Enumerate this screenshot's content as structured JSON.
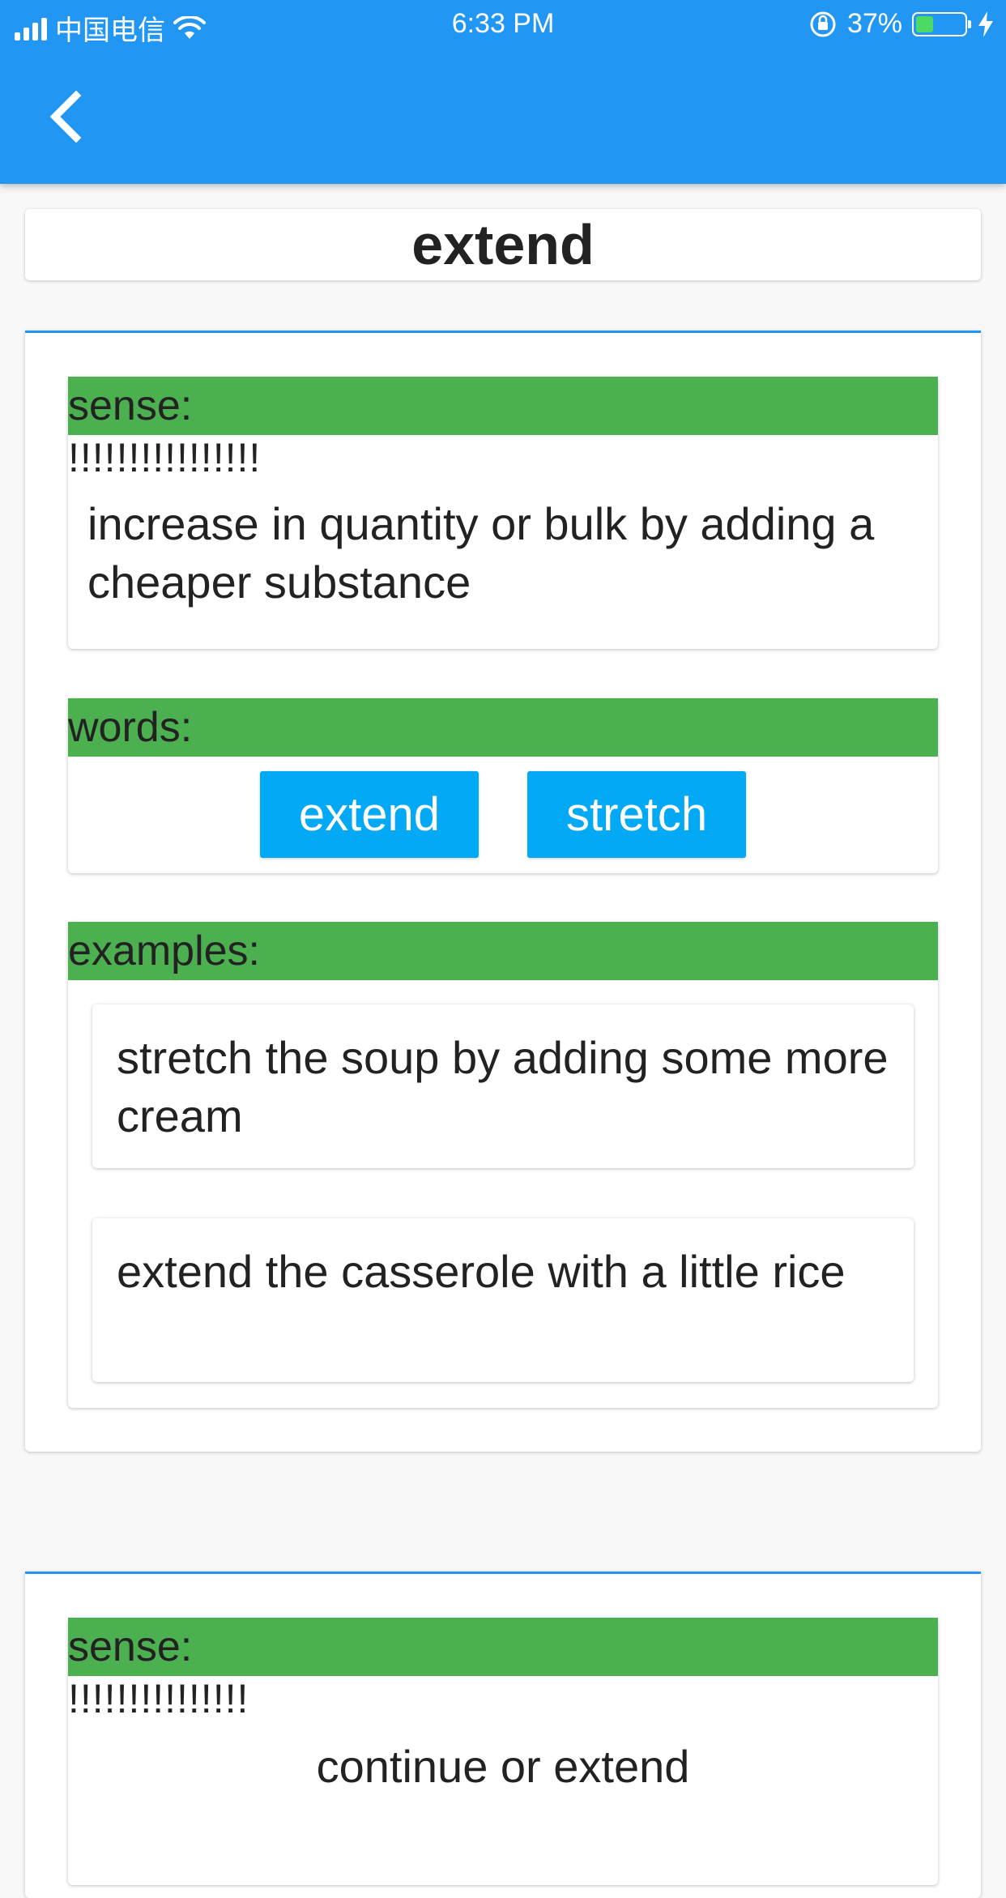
{
  "status_bar": {
    "carrier": "中国电信",
    "time": "6:33 PM",
    "battery_percent": "37%",
    "battery_level": 0.37
  },
  "colors": {
    "app_bar": "#2196f3",
    "section_header": "#4caf50",
    "chip": "#03a9f4"
  },
  "title": "extend",
  "senses": [
    {
      "sense_label": "sense:",
      "marker": "!!!!!!!!!!!!!!!!",
      "definition": "increase in quantity or bulk by adding a cheaper substance",
      "words_label": "words:",
      "words": [
        "extend",
        "stretch"
      ],
      "examples_label": "examples:",
      "examples": [
        "stretch the soup by adding some more cream",
        "extend the casserole with a little rice"
      ]
    },
    {
      "sense_label": "sense:",
      "marker": "!!!!!!!!!!!!!!!",
      "definition": "continue or extend"
    }
  ]
}
